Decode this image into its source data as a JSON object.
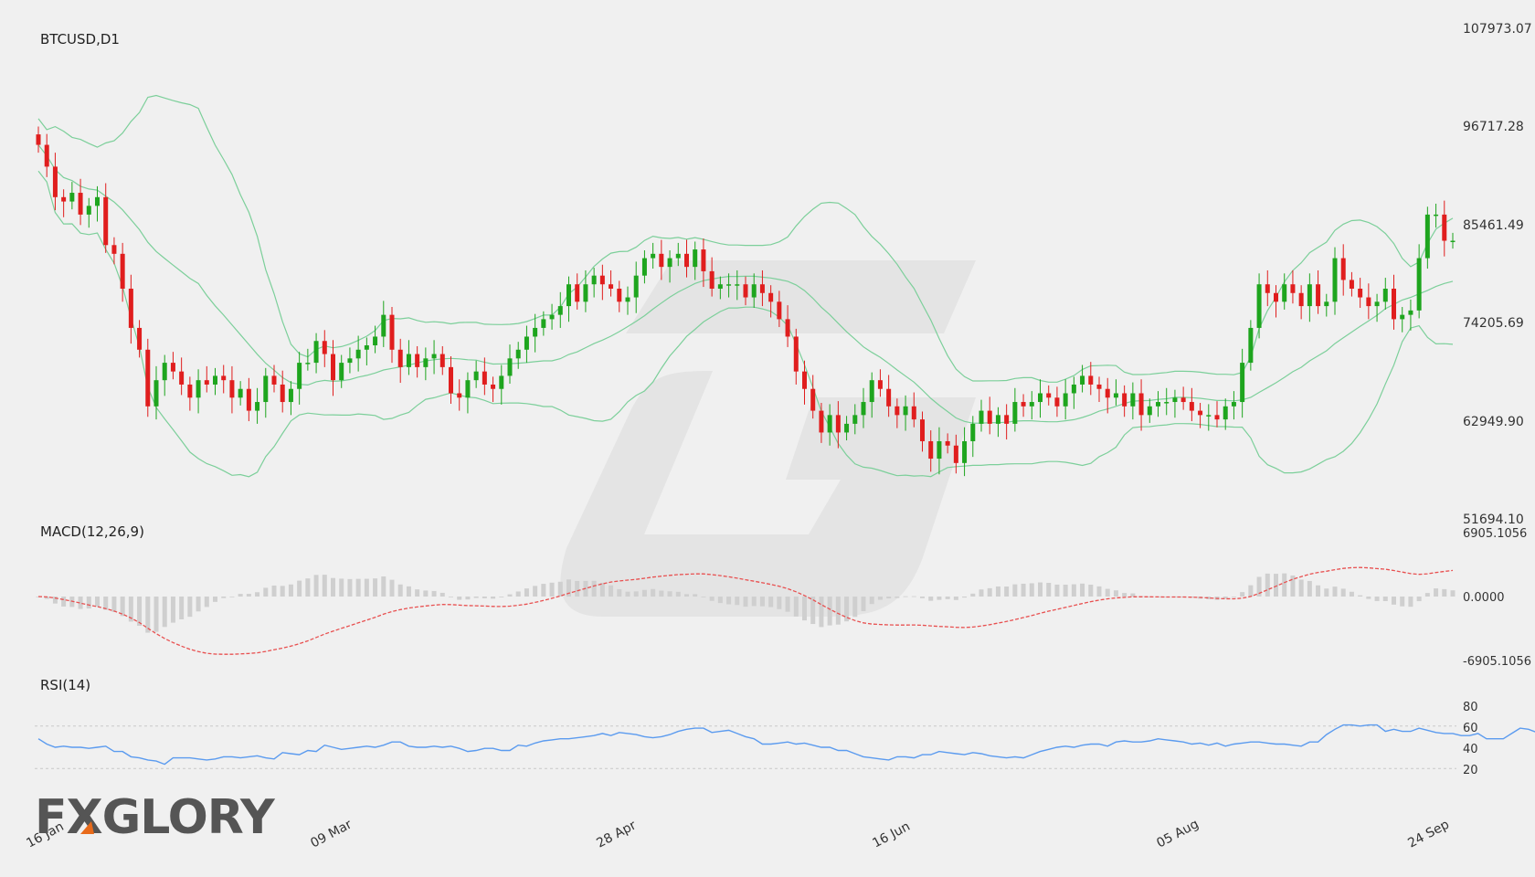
{
  "header": {
    "symbol_title": "BTCUSD,D1"
  },
  "indicators": {
    "macd_label": "MACD(12,26,9)",
    "rsi_label": "RSI(14)"
  },
  "brand": {
    "logo_text": "FXGLORY",
    "accent_color": "#e86a1a"
  },
  "colors": {
    "up_candle": "#1ea51e",
    "down_candle": "#e01e1e",
    "bollinger": "#7ccf9a",
    "macd_signal": "#e85050",
    "macd_hist": "#cfcfcf",
    "rsi_line": "#5b9bef",
    "rsi_levels": "#c8c8c8",
    "background": "#f0f0f0"
  },
  "chart_data": [
    {
      "type": "candlestick",
      "title": "BTCUSD,D1",
      "price_ticks": [
        "107973.07",
        "96717.28",
        "85461.49",
        "74205.69",
        "62949.90",
        "51694.10"
      ],
      "x_ticks": [
        "16 Jan",
        "09 Mar",
        "28 Apr",
        "16 Jun",
        "05 Aug",
        "24 Sep"
      ],
      "ylim": [
        51694.1,
        107973.07
      ],
      "close": [
        94500,
        92000,
        88500,
        88000,
        89000,
        86500,
        87500,
        88500,
        83000,
        82000,
        78000,
        73500,
        71000,
        64500,
        67500,
        69500,
        68500,
        67000,
        65500,
        67500,
        67000,
        68000,
        67500,
        65500,
        66500,
        64000,
        65000,
        68000,
        67000,
        65000,
        66500,
        69500,
        69500,
        72000,
        70500,
        67500,
        69500,
        70000,
        71000,
        71500,
        72500,
        75000,
        71000,
        69000,
        70500,
        69000,
        70000,
        70500,
        69000,
        66000,
        65500,
        67500,
        68500,
        67000,
        66500,
        68000,
        70000,
        71000,
        72500,
        73500,
        74500,
        75000,
        76000,
        78500,
        76500,
        78500,
        79500,
        78500,
        78000,
        76500,
        77000,
        79500,
        81500,
        82000,
        80500,
        81500,
        82000,
        80500,
        82500,
        80000,
        78000,
        78500,
        78500,
        78500,
        77000,
        78500,
        77500,
        76500,
        74500,
        72500,
        68500,
        66500,
        64000,
        61500,
        63500,
        61500,
        62500,
        63500,
        65000,
        67500,
        66500,
        64500,
        63500,
        64500,
        63000,
        60500,
        58500,
        60500,
        60000,
        58000,
        60500,
        62500,
        64000,
        62500,
        63500,
        62500,
        65000,
        64500,
        65000,
        66000,
        65500,
        64500,
        66000,
        67000,
        68000,
        67000,
        66500,
        65500,
        66000,
        64500,
        66000,
        63500,
        64500,
        65000,
        65000,
        65500,
        65000,
        64000,
        63500,
        63500,
        63000,
        64500,
        65000,
        69500,
        73500,
        78500,
        77500,
        76500,
        78500,
        77500,
        76000,
        78500,
        76000,
        76500,
        81500,
        79000,
        78000,
        77000,
        76000,
        76500,
        78000,
        74500,
        75000,
        75500,
        81500,
        86500,
        86500,
        83500,
        83500
      ]
    },
    {
      "type": "bar",
      "title": "MACD(12,26,9)",
      "y_ticks": [
        "6905.1056",
        "0.0000",
        "-6905.1056"
      ],
      "ylim": [
        -6905.1056,
        6905.1056
      ]
    },
    {
      "type": "line",
      "title": "RSI(14)",
      "y_ticks": [
        "80",
        "60",
        "40",
        "20"
      ],
      "ylim": [
        0,
        100
      ],
      "levels": [
        70,
        30
      ],
      "values": [
        58,
        53,
        50,
        51,
        50,
        50,
        49,
        50,
        51,
        46,
        46,
        41,
        40,
        38,
        37,
        34,
        40,
        40,
        40,
        39,
        38,
        39,
        41,
        41,
        40,
        41,
        42,
        40,
        39,
        45,
        44,
        43,
        47,
        46,
        52,
        50,
        48,
        49,
        50,
        51,
        50,
        52,
        55,
        55,
        51,
        50,
        50,
        51,
        50,
        51,
        49,
        46,
        47,
        49,
        49,
        47,
        47,
        52,
        51,
        54,
        56,
        57,
        58,
        58,
        59,
        60,
        61,
        63,
        61,
        64,
        63,
        62,
        60,
        59,
        60,
        62,
        65,
        67,
        68,
        68,
        64,
        65,
        66,
        63,
        60,
        58,
        53,
        53,
        54,
        55,
        53,
        54,
        52,
        50,
        50,
        47,
        47,
        44,
        41,
        40,
        39,
        38,
        41,
        41,
        40,
        43,
        43,
        46,
        45,
        44,
        43,
        45,
        44,
        42,
        41,
        40,
        41,
        40,
        43,
        46,
        48,
        50,
        51,
        50,
        52,
        53,
        53,
        51,
        55,
        56,
        55,
        55,
        56,
        58,
        57,
        56,
        55,
        53,
        54,
        52,
        54,
        51,
        53,
        54,
        55,
        55,
        54,
        53,
        53,
        52,
        51,
        55,
        55,
        62,
        67,
        71,
        71,
        70,
        71,
        71,
        65,
        67,
        65,
        65,
        68,
        66,
        64,
        63,
        63,
        61,
        61,
        63,
        58,
        58,
        58,
        63,
        68,
        67,
        64,
        64
      ]
    }
  ]
}
